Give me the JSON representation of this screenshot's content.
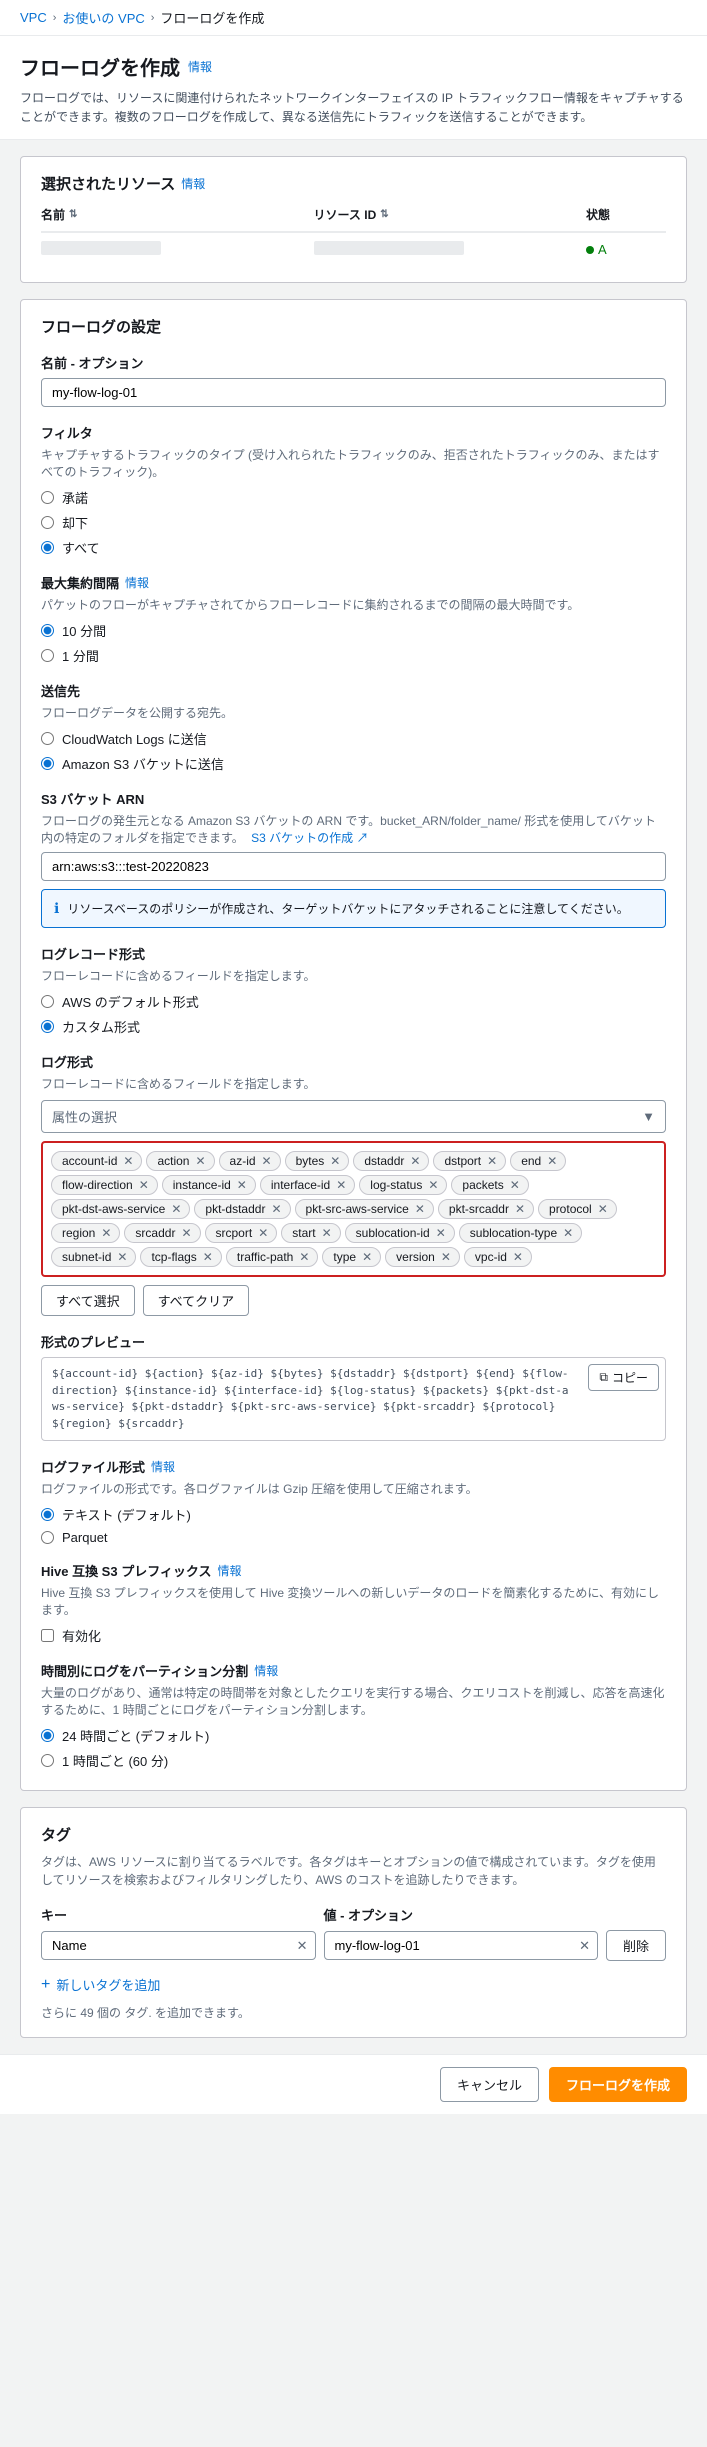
{
  "breadcrumb": {
    "items": [
      "VPC",
      "お使いの VPC",
      "フローログを作成"
    ],
    "separators": [
      ">",
      ">"
    ]
  },
  "page": {
    "title": "フローログを作成",
    "info_label": "情報",
    "description": "フローログでは、リソースに関連付けられたネットワークインターフェイスの IP トラフィックフロー情報をキャプチャすることができます。複数のフローログを作成して、異なる送信先にトラフィックを送信することができます。"
  },
  "selected_resources": {
    "title": "選択されたリソース",
    "info_label": "情報",
    "columns": [
      "名前",
      "リソース ID",
      "状態"
    ],
    "row": {
      "name": "",
      "resource_id": "",
      "status": "A"
    }
  },
  "flow_log_settings": {
    "title": "フローログの設定",
    "name_section": {
      "label": "名前 - オプション",
      "value": "my-flow-log-01",
      "placeholder": "my-flow-log-01"
    },
    "filter_section": {
      "label": "フィルタ",
      "description": "キャプチャするトラフィックのタイプ (受け入れられたトラフィックのみ、拒否されたトラフィックのみ、またはすべてのトラフィック)。",
      "options": [
        "承諾",
        "却下",
        "すべて"
      ],
      "selected": "すべて"
    },
    "interval_section": {
      "label": "最大集約間隔",
      "info_label": "情報",
      "description": "パケットのフローがキャプチャされてからフローレコードに集約されるまでの間隔の最大時間です。",
      "options": [
        "10 分間",
        "1 分間"
      ],
      "selected": "10 分間"
    },
    "destination_section": {
      "label": "送信先",
      "description": "フローログデータを公開する宛先。",
      "options": [
        "CloudWatch Logs に送信",
        "Amazon S3 バケットに送信"
      ],
      "selected": "Amazon S3 バケットに送信"
    },
    "s3_arn_section": {
      "label": "S3 バケット ARN",
      "description": "フローログの発生元となる Amazon S3 バケットの ARN です。bucket_ARN/folder_name/ 形式を使用してバケット内の特定のフォルダを指定できます。",
      "s3_link_label": "S3 バケットの作成",
      "value": "arn:aws:s3:::test-20220823",
      "placeholder": "arn:aws:s3:::test-20220823"
    },
    "info_box_text": "リソースベースのポリシーが作成され、ターゲットバケットにアタッチされることに注意してください。",
    "log_record_format_section": {
      "label": "ログレコード形式",
      "description": "フローレコードに含めるフィールドを指定します。",
      "options": [
        "AWS のデフォルト形式",
        "カスタム形式"
      ],
      "selected": "カスタム形式"
    },
    "log_format_section": {
      "label": "ログ形式",
      "description": "フローレコードに含めるフィールドを指定します。",
      "dropdown_placeholder": "属性の選択",
      "tags": [
        "account-id",
        "action",
        "az-id",
        "bytes",
        "dstaddr",
        "dstport",
        "end",
        "flow-direction",
        "instance-id",
        "interface-id",
        "log-status",
        "packets",
        "pkt-dst-aws-service",
        "pkt-dstaddr",
        "pkt-src-aws-service",
        "pkt-srcaddr",
        "protocol",
        "region",
        "srcaddr",
        "srcport",
        "start",
        "sublocation-id",
        "sublocation-type",
        "subnet-id",
        "tcp-flags",
        "traffic-path",
        "type",
        "version",
        "vpc-id"
      ]
    },
    "select_all_button": "すべて選択",
    "clear_all_button": "すべてクリア",
    "format_preview_section": {
      "label": "形式のプレビュー",
      "preview_text": "${account-id} ${action} ${az-id} ${bytes} ${dstaddr} ${dstport} ${end} ${flow-direction} ${instance-id} ${interface-id} ${log-status} ${packets} ${pkt-dst-aws-service} ${pkt-dstaddr} ${pkt-src-aws-service} ${pkt-srcaddr} ${protocol} ${region} ${srcaddr}",
      "copy_button_label": "コピー"
    },
    "log_file_format_section": {
      "label": "ログファイル形式",
      "info_label": "情報",
      "description": "ログファイルの形式です。各ログファイルは Gzip 圧縮を使用して圧縮されます。",
      "options": [
        "テキスト (デフォルト)",
        "Parquet"
      ],
      "selected": "テキスト (デフォルト)"
    },
    "hive_prefix_section": {
      "label": "Hive 互換 S3 プレフィックス",
      "info_label": "情報",
      "description": "Hive 互換 S3 プレフィックスを使用して Hive 変換ツールへの新しいデータのロードを簡素化するために、有効にします。",
      "checkbox_label": "有効化",
      "checked": false
    },
    "partition_section": {
      "label": "時間別にログをパーティション分割",
      "info_label": "情報",
      "description": "大量のログがあり、通常は特定の時間帯を対象としたクエリを実行する場合、クエリコストを削減し、応答を高速化するために、1 時間ごとにログをパーティション分割します。",
      "options": [
        "24 時間ごと (デフォルト)",
        "1 時間ごと (60 分)"
      ],
      "selected": "24 時間ごと (デフォルト)"
    }
  },
  "tags_section": {
    "title": "タグ",
    "description": "タグは、AWS リソースに割り当てるラベルです。各タグはキーとオプションの値で構成されています。タグを使用してリソースを検索およびフィルタリングしたり、AWS のコストを追跡したりできます。",
    "key_label": "キー",
    "value_label": "値 - オプション",
    "tag_rows": [
      {
        "key": "Name",
        "value": "my-flow-log-01"
      }
    ],
    "add_tag_button": "新しいタグを追加",
    "add_tag_hint": "さらに 49 個の タグ. を追加できます。",
    "delete_button": "削除"
  },
  "footer": {
    "cancel_label": "キャンセル",
    "submit_label": "フローログを作成"
  }
}
